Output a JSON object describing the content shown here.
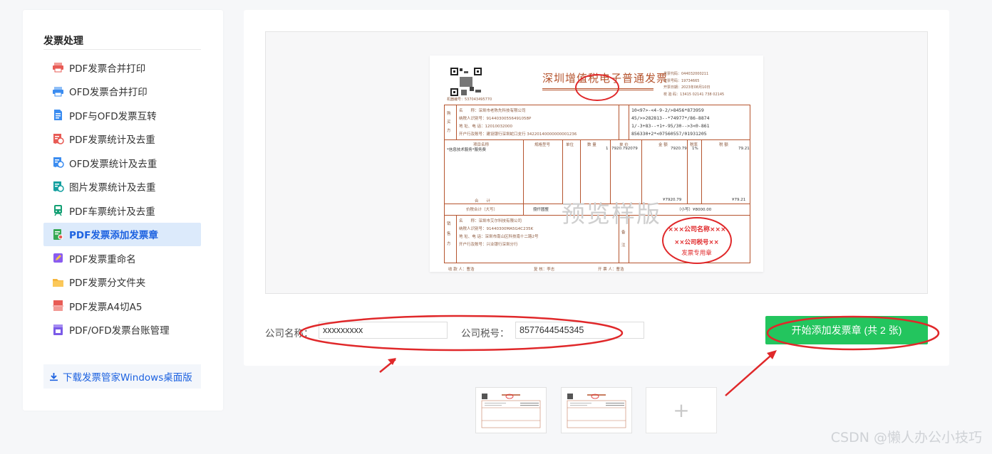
{
  "sidebar": {
    "title": "发票处理",
    "items": [
      {
        "label": "PDF发票合并打印",
        "icon": "printer-red-icon",
        "color": "#e85b55"
      },
      {
        "label": "OFD发票合并打印",
        "icon": "printer-blue-icon",
        "color": "#3b8cf0"
      },
      {
        "label": "PDF与OFD发票互转",
        "icon": "doc-convert-icon",
        "color": "#3b8cf0"
      },
      {
        "label": "PDF发票统计及去重",
        "icon": "receipt-stat-red-icon",
        "color": "#e85b55"
      },
      {
        "label": "OFD发票统计及去重",
        "icon": "receipt-stat-blue-icon",
        "color": "#3b8cf0"
      },
      {
        "label": "图片发票统计及去重",
        "icon": "receipt-stat-teal-icon",
        "color": "#14a0a0"
      },
      {
        "label": "PDF车票统计及去重",
        "icon": "train-icon",
        "color": "#14a074"
      },
      {
        "label": "PDF发票添加发票章",
        "icon": "stamp-doc-icon",
        "color": "#35a853",
        "active": true
      },
      {
        "label": "PDF发票重命名",
        "icon": "rename-icon",
        "color": "#8a5cf0"
      },
      {
        "label": "PDF发票分文件夹",
        "icon": "folder-icon",
        "color": "#f6b53b"
      },
      {
        "label": "PDF发票A4切A5",
        "icon": "cut-page-icon",
        "color": "#e85b55"
      },
      {
        "label": "PDF/OFD发票台账管理",
        "icon": "ledger-icon",
        "color": "#7b5be8"
      }
    ],
    "download_label": "下载发票管家Windows桌面版"
  },
  "invoice": {
    "title": "深圳增值税电子普通发票",
    "watermark": "预览样版",
    "meta_lines": [
      "发票代码：044032000211",
      "发票号码：19734665",
      "开票日期：2023年08月10日",
      "校 验 码：13415 02141 738 02145"
    ],
    "machine_no": "机器编号：537043495770",
    "buyer_label": "购买方",
    "seller_label": "销售方",
    "buyer_name": "名　　称：深圳市老陈先科技有限公司",
    "buyer_tax": "纳税人识别号：91440300556491058P",
    "buyer_addr": "地 址、电 话：12010032000",
    "buyer_bank": "开户行及账号：建设银行深圳蛇口支行 34220140000000001236",
    "cipher": [
      "10<97>-<4-9-2/>8456*873959",
      "45/>>282813--*74977*/86-8874",
      "1/-3+83--+1+-95/30-->3<0-861",
      "856330+2*<07560557/01931205"
    ],
    "item_header": [
      "项目名称",
      "规格型号",
      "单位",
      "数 量",
      "单 价",
      "金 额",
      "税率",
      "税 额"
    ],
    "item_name": "*信息技术服务*服务费",
    "item_qty": "1",
    "item_price": "7920.792079",
    "item_amount": "7920.79",
    "item_rate": "1%",
    "item_tax": "79.21",
    "subtotal_label": "合　　计",
    "subtotal_amount": "¥7920.79",
    "subtotal_tax": "¥79.21",
    "total_label": "价税合计（大写）",
    "total_cn": "捌仟圆整",
    "total_small": "（小写）¥8000.00",
    "seller_name": "名　　称：深圳市艾尔科技有限公司",
    "seller_tax": "纳税人识别号：91440300MA5G4C235K",
    "seller_addr": "地 址、电 话：深圳市南山区科技南十二路2号",
    "seller_bank": "开户行及账号：兴业银行深圳分行",
    "remark_label": "备注",
    "payee": "收 款 人：曹浩",
    "checker": "复 核：李志",
    "issuer": "开 票 人：曹浩",
    "stamp_top": "×××公司名称×××",
    "stamp_mid": "××公司税号××",
    "stamp_bot": "发票专用章"
  },
  "form": {
    "company_label": "公司名称：",
    "company_value": "xxxxxxxxx",
    "tax_label": "公司税号：",
    "tax_value": "8577644545345",
    "start_button": "开始添加发票章 (共 2 张)"
  },
  "thumbnails": {
    "count": 2,
    "add_symbol": "+"
  },
  "watermark_brand": "CSDN @懒人办公小技巧",
  "colors": {
    "accent": "#1d62e0",
    "active_bg": "#dceafb",
    "button": "#23c55e",
    "annotation": "#e0282a"
  }
}
